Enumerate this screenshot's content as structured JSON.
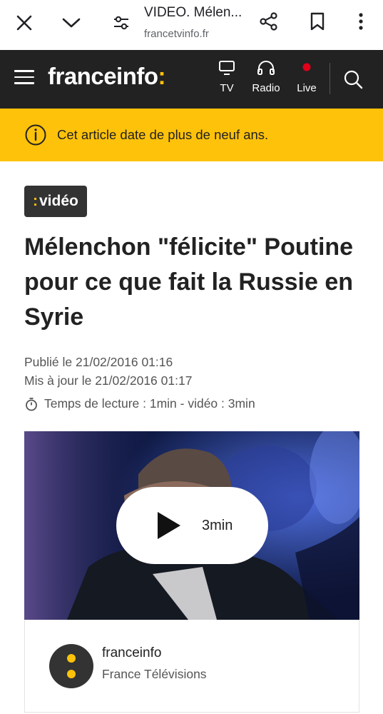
{
  "browser": {
    "title": "VIDEO. Mélen...",
    "domain": "francetvinfo.fr",
    "icons": [
      "close-icon",
      "chevron-down-icon",
      "site-settings-icon",
      "share-icon",
      "bookmark-icon",
      "more-vert-icon"
    ]
  },
  "header": {
    "logo_text": "franceinfo",
    "logo_colon": ":",
    "nav": [
      {
        "label": "TV",
        "icon": "tv-icon"
      },
      {
        "label": "Radio",
        "icon": "headphones-icon"
      },
      {
        "label": "Live",
        "icon": "live-dot-icon"
      }
    ],
    "colors": {
      "background": "#222222",
      "accent": "#fec20b",
      "live": "#e2001a"
    }
  },
  "banner": {
    "text": "Cet article date de plus de neuf ans.",
    "icon": "info-icon",
    "color": "#fec20b"
  },
  "article": {
    "badge_colon": ":",
    "badge_label": "vidéo",
    "title": "Mélenchon \"félicite\" Poutine pour ce que fait la Russie en Syrie",
    "published": "Publié le 21/02/2016 01:16",
    "updated": "Mis à jour le 21/02/2016 01:17",
    "reading_time": "Temps de lecture : 1min - vidéo : 3min"
  },
  "video": {
    "duration": "3min",
    "icon": "play-icon"
  },
  "source": {
    "name": "franceinfo",
    "org": "France Télévisions"
  }
}
